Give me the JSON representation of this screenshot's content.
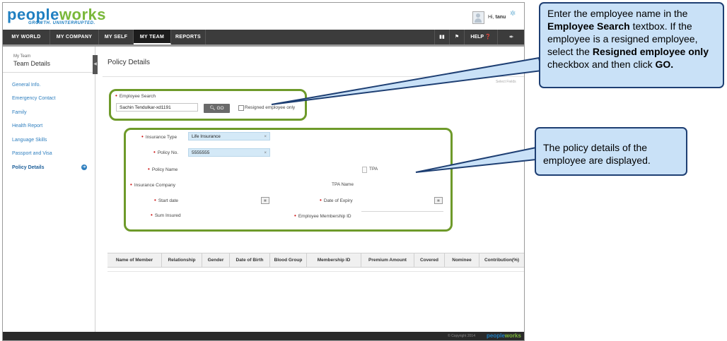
{
  "header": {
    "logo": "peopleworks",
    "logo_tagline": "GROWTH. UNINTERRUPTED.",
    "greeting_prefix": "Hi,",
    "user_name": "tanu"
  },
  "nav": {
    "items": [
      "MY WORLD",
      "MY COMPANY",
      "MY SELF",
      "MY TEAM",
      "REPORTS"
    ],
    "active": "MY TEAM",
    "help_label": "HELP"
  },
  "sidebar": {
    "section_small": "My Team",
    "section_title": "Team Details",
    "items": [
      "General Info.",
      "Emergency Contact",
      "Family",
      "Health Report",
      "Language Skills",
      "Passport and Visa",
      "Policy Details"
    ],
    "active": "Policy Details"
  },
  "main": {
    "page_title": "Policy Details",
    "cut_label": "Select Fields",
    "search": {
      "label": "Employee Search",
      "value": "Sachin Tendulkar-xd1191",
      "go_label": "GO",
      "resigned_label": "Resigned employee only",
      "resigned_checked": false
    },
    "policy": {
      "insurance_type_label": "Insurance Type",
      "insurance_type_value": "Life Insurance",
      "policy_no_label": "Policy No.",
      "policy_no_value": "5555555",
      "policy_name_label": "Policy Name",
      "tpa_label": "TPA",
      "insurance_company_label": "Insurance Company",
      "tpa_name_label": "TPA Name",
      "start_date_label": "Start date",
      "date_of_expiry_label": "Date of Expiry",
      "sum_insured_label": "Sum Insured",
      "employee_membership_label": "Employee Membership ID"
    },
    "table": {
      "columns": [
        "Name of Member",
        "Relationship",
        "Gender",
        "Date of Birth",
        "Blood Group",
        "Membership ID",
        "Premium Amount",
        "Covered",
        "Nominee",
        "Contribution(%)"
      ]
    }
  },
  "footer": {
    "copyright": "© Copyright 2014",
    "logo": "peopleworks"
  },
  "callouts": {
    "search_callout": {
      "p1": "Enter the employee name in the ",
      "b1": "Employee Search",
      "p2": " textbox.  If the employee is a resigned employee, select the ",
      "b2": "Resigned employee only",
      "p3": " checkbox and then click ",
      "b3": "GO."
    },
    "policy_callout": "The policy details of the employee are displayed."
  },
  "colors": {
    "accent_blue": "#1f7fc1",
    "brand_green": "#7ab83a",
    "highlight_border": "#6e9a2a",
    "callout_fill": "#c9e1f7",
    "callout_border": "#1e3f73"
  }
}
